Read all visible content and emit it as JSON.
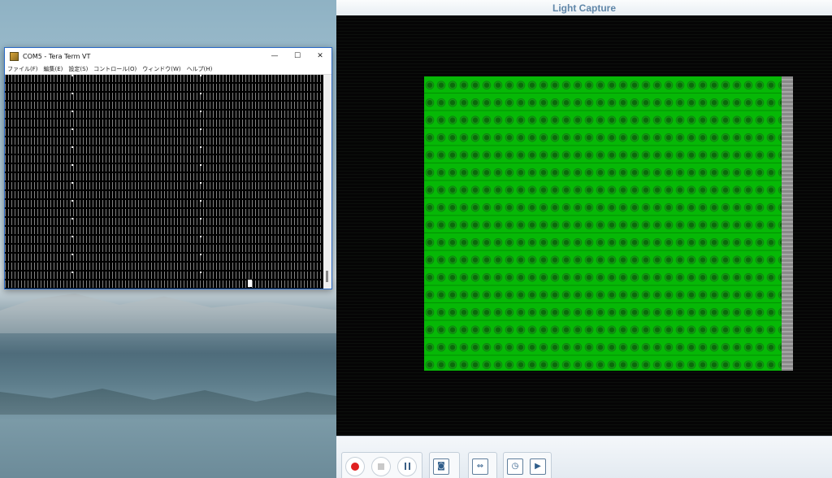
{
  "teraterm": {
    "title": "COM5 - Tera Term VT",
    "buttons": {
      "minimize": "—",
      "maximize": "☐",
      "close": "✕"
    },
    "menu": [
      "ファイル(F)",
      "編集(E)",
      "設定(S)",
      "コントロール(O)",
      "ウィンドウ(W)",
      "ヘルプ(H)"
    ]
  },
  "lightcapture": {
    "title": "Light Capture",
    "toolbar": {
      "record_icon": "record-icon",
      "stop_icon": "stop-icon",
      "pause_icon": "pause-icon",
      "snapshot_icon": "camera-icon",
      "fit_icon": "fit-width-icon",
      "timer_icon": "clock-icon",
      "play_icon": "play-icon"
    },
    "colors": {
      "panel_green": "#06b806",
      "title_blue": "#5f86a8",
      "record_red": "#e02020"
    }
  }
}
